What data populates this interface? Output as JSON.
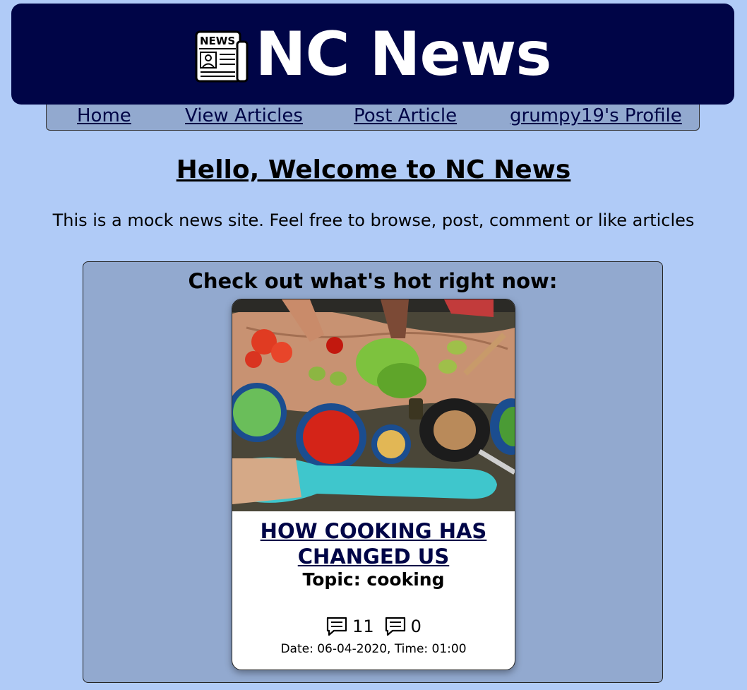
{
  "header": {
    "title": "NC News",
    "logo_icon": "newspaper-icon",
    "logo_text": "NEWS"
  },
  "nav": {
    "items": [
      {
        "label": "Home"
      },
      {
        "label": "View Articles"
      },
      {
        "label": "Post Article"
      },
      {
        "label": "grumpy19's Profile"
      }
    ]
  },
  "welcome": {
    "heading": "Hello, Welcome to NC News",
    "intro": "This is a mock news site. Feel free to browse, post, comment or like articles"
  },
  "hot": {
    "heading": "Check out what's hot right now:",
    "article": {
      "title": "HOW COOKING HAS CHANGED US",
      "topic": "Topic: cooking",
      "comment_count": "11",
      "votes": "0",
      "date": "Date: 06-04-2020, Time: 01:00",
      "image_icon": "food-photo"
    }
  },
  "colors": {
    "background": "#b0cbf7",
    "header": "#000547",
    "nav": "#92a9cf",
    "link": "#000547"
  }
}
